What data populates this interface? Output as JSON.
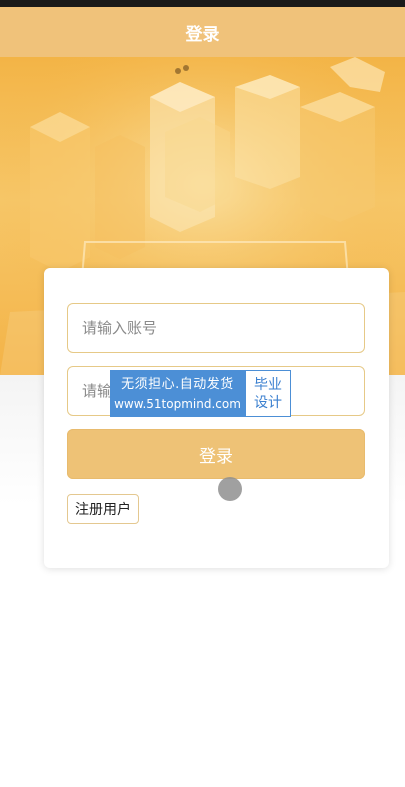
{
  "header": {
    "title": "登录"
  },
  "form": {
    "account_placeholder": "请输入账号",
    "password_placeholder": "请输入密码",
    "password_visible_label": "请输",
    "login_label": "登录",
    "register_label": "注册用户"
  },
  "watermark": {
    "line1": "无须担心.自动发货",
    "line2": "www.51topmind.com",
    "right1": "毕业",
    "right2": "设计"
  },
  "colors": {
    "accent": "#f0c27a",
    "banner": "#f3b446",
    "border": "#e6c987",
    "watermark": "#4c8fd6"
  }
}
